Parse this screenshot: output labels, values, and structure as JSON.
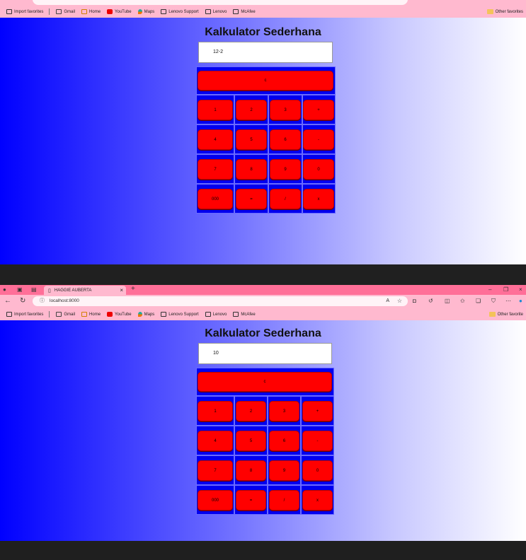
{
  "browser": {
    "url": "localhost:8000",
    "tab_title": "HAGGIE AUBERTA",
    "new_tab_symbol": "+",
    "favorites": [
      {
        "label": "Import favorites",
        "icon": "import-icon"
      },
      {
        "label": "Gmail",
        "icon": "mail-icon"
      },
      {
        "label": "Home",
        "icon": "home-icon"
      },
      {
        "label": "YouTube",
        "icon": "youtube-icon"
      },
      {
        "label": "Maps",
        "icon": "map-pin-icon"
      },
      {
        "label": "Lenovo Support",
        "icon": "page-icon"
      },
      {
        "label": "Lenovo",
        "icon": "page-icon"
      },
      {
        "label": "McAfee",
        "icon": "page-icon"
      }
    ],
    "other_favorites_top": "Other favorites",
    "other_favorites_bottom": "Other favorite"
  },
  "top_view": {
    "title": "Kalkulator Sederhana",
    "display_value": "12-2"
  },
  "bottom_view": {
    "title": "Kalkulator Sederhana",
    "display_value": "10"
  },
  "keys": {
    "clear": "c",
    "row1": [
      "1",
      "2",
      "3",
      "+"
    ],
    "row2": [
      "4",
      "5",
      "6",
      "-"
    ],
    "row3": [
      "7",
      "8",
      "9",
      "0"
    ],
    "row4": [
      "000",
      "=",
      "/",
      "x"
    ]
  },
  "colors": {
    "button": "#ff0000",
    "calculator_bg": "#0000ee",
    "gradient_start": "#0000ff",
    "gradient_end": "#ffffff",
    "browser_chrome": "#ffb9cf"
  }
}
